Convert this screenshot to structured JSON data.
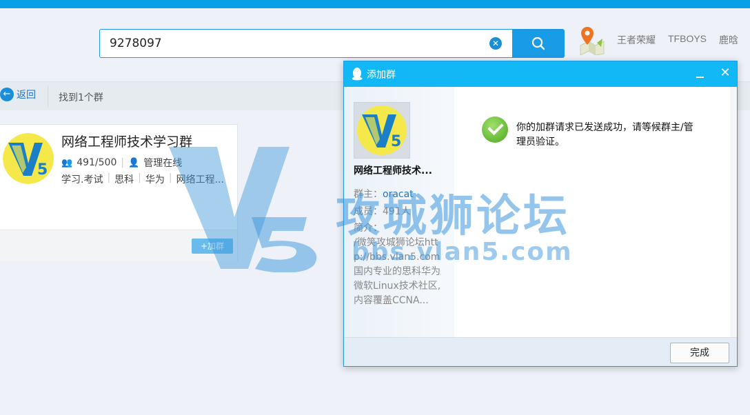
{
  "search": {
    "value": "9278097"
  },
  "hot_links": [
    "王者荣耀",
    "TFBOYS",
    "鹿晗"
  ],
  "toolbar": {
    "back_label": "返回",
    "result_count": "找到1个群"
  },
  "result_card": {
    "title": "网络工程师技术学习群",
    "members": "491/500",
    "admin_status": "管理在线",
    "tags": [
      "学习.考试",
      "思科",
      "华为",
      "网络工程..."
    ],
    "join_label": "+加群"
  },
  "watermark": {
    "text": "攻城狮论坛",
    "url": "bbs.vlan5.com"
  },
  "dialog": {
    "title": "添加群",
    "group_name": "网络工程师技术...",
    "owner_label": "群主：",
    "owner": "oracat",
    "members_label": "成员：",
    "members": "491人",
    "intro_label": "简介：",
    "intro": "/微笑攻城狮论坛http://bbs.vlan5.com国内专业的思科华为微软Linux技术社区,内容覆盖CCNA...",
    "message": "你的加群请求已发送成功，请等候群主/管理员验证。",
    "done_label": "完成"
  },
  "colors": {
    "accent": "#12b7f5",
    "search_blue": "#1a9be6",
    "link": "#1a73c8"
  },
  "icons": [
    "search-icon",
    "clear-icon",
    "map-pin-icon",
    "back-arrow-icon",
    "people-icon",
    "admin-icon",
    "qq-penguin-icon",
    "minimize-icon",
    "close-icon",
    "success-check-icon"
  ]
}
